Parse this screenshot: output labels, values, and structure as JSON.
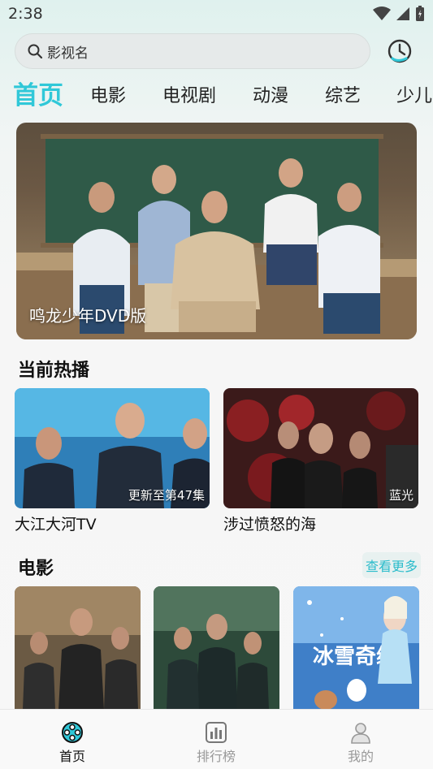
{
  "status_bar": {
    "time": "2:38"
  },
  "search": {
    "placeholder": "影视名"
  },
  "tabs": [
    {
      "label": "首页",
      "active": true
    },
    {
      "label": "电影"
    },
    {
      "label": "电视剧"
    },
    {
      "label": "动漫"
    },
    {
      "label": "综艺"
    },
    {
      "label": "少儿"
    }
  ],
  "banner": {
    "title": "鸣龙少年DVD版"
  },
  "hot": {
    "title": "当前热播",
    "items": [
      {
        "name": "大江大河TV",
        "badge": "更新至第47集"
      },
      {
        "name": "涉过愤怒的海",
        "badge": "蓝光"
      }
    ]
  },
  "movies": {
    "title": "电影",
    "more_label": "查看更多"
  },
  "bottom_nav": [
    {
      "label": "首页",
      "icon": "film-reel-icon",
      "active": true
    },
    {
      "label": "排行榜",
      "icon": "bar-chart-icon"
    },
    {
      "label": "我的",
      "icon": "user-icon"
    }
  ],
  "colors": {
    "accent": "#30c8d8"
  }
}
